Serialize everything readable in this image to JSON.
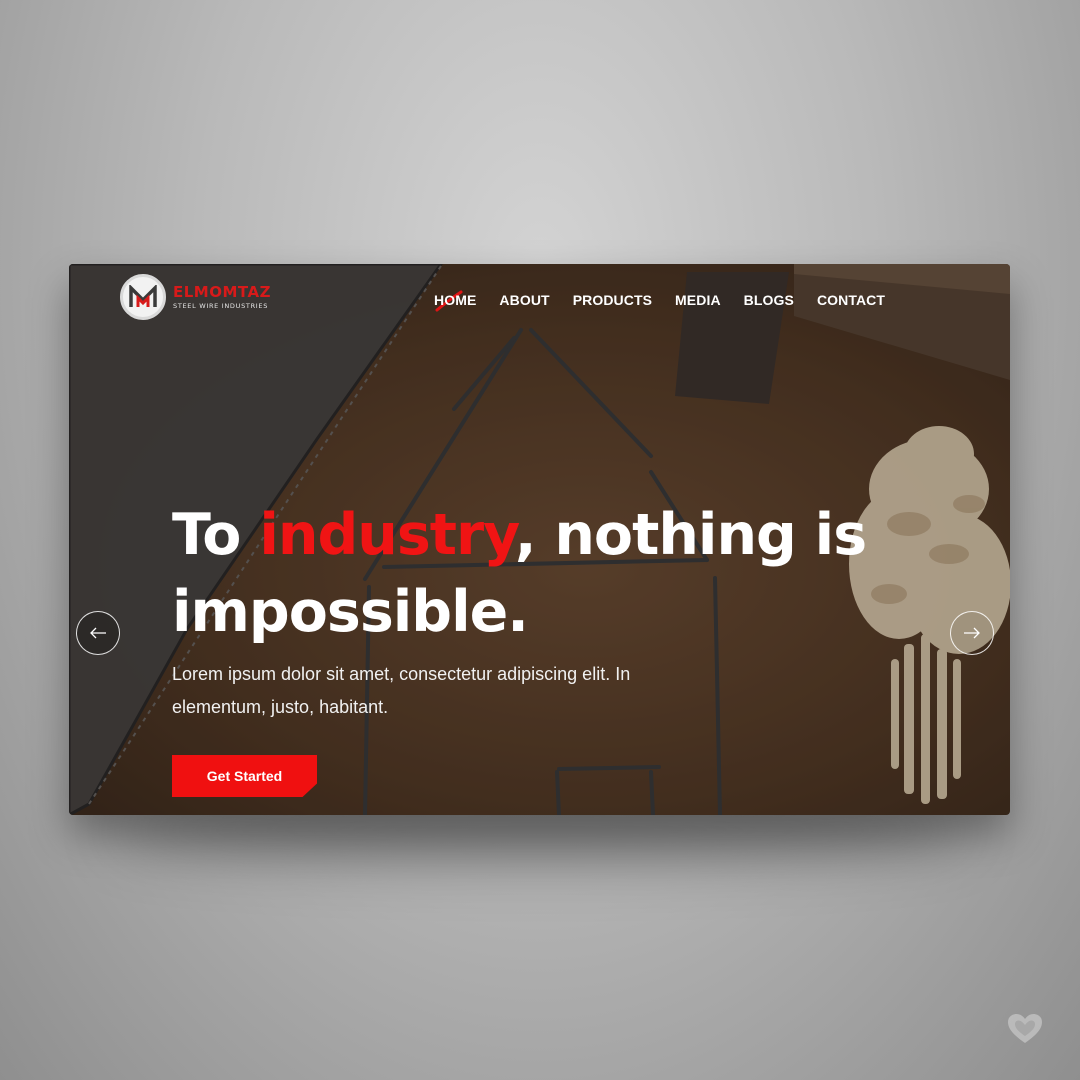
{
  "brand": {
    "name": "ELMOMTAZ",
    "tagline": "STEEL WIRE INDUSTRIES",
    "badge_letter": "M"
  },
  "nav": {
    "items": [
      {
        "label": "HOME",
        "active": true
      },
      {
        "label": "ABOUT"
      },
      {
        "label": "PRODUCTS"
      },
      {
        "label": "MEDIA"
      },
      {
        "label": "BLOGS"
      },
      {
        "label": "CONTACT"
      }
    ]
  },
  "hero": {
    "title_pre": "To ",
    "title_accent": "industry",
    "title_post": ", nothing is impossible.",
    "subtitle": "Lorem ipsum dolor sit amet, consectetur adipiscing elit. In elementum, justo, habitant.",
    "cta_label": "Get Started"
  },
  "slider": {
    "prev_icon": "arrow-left-icon",
    "next_icon": "arrow-right-icon"
  },
  "colors": {
    "accent": "#f01414",
    "text": "#ffffff",
    "background": "#b9b9b9"
  }
}
